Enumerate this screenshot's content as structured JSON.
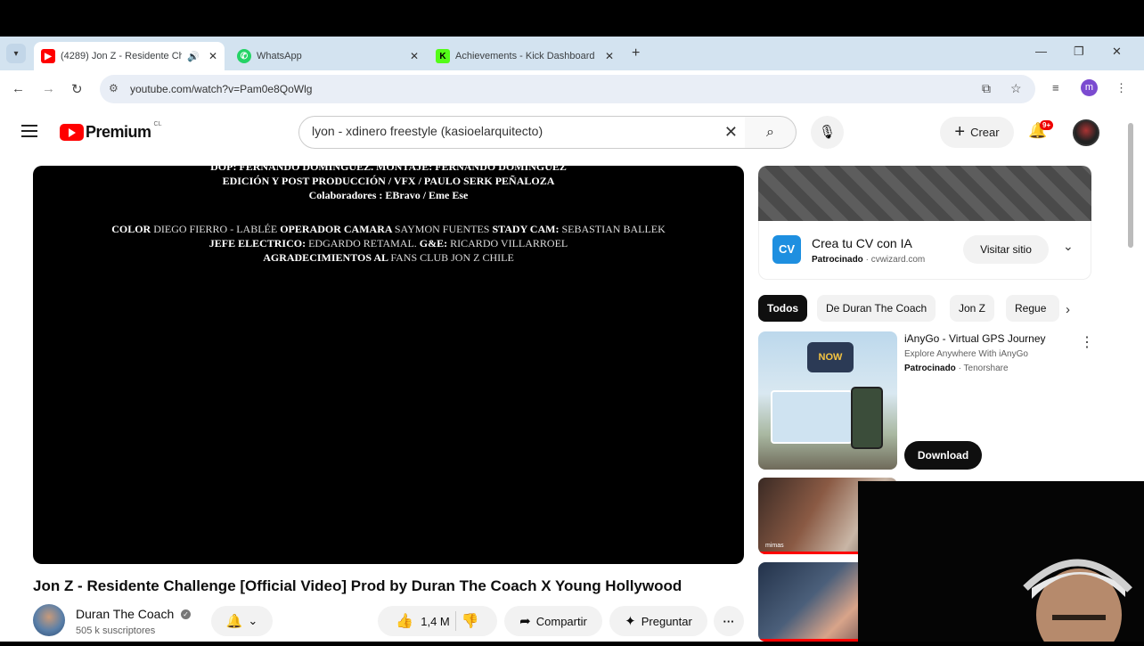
{
  "browser": {
    "tabs": [
      {
        "title": "(4289) Jon Z - Residente Ch",
        "active": true
      },
      {
        "title": "WhatsApp",
        "active": false
      },
      {
        "title": "Achievements - Kick Dashboard",
        "active": false
      }
    ],
    "url": "youtube.com/watch?v=Pam0e8QoWlg",
    "profile_initial": "m"
  },
  "header": {
    "brand": "Premium",
    "country": "CL",
    "search_value": "lyon - xdinero freestyle (kasioelarquitecto)",
    "create_label": "Crear",
    "notif_count": "9+"
  },
  "video": {
    "credits": [
      {
        "text": "DOP: FERNANDO DOMINGUEZ. MONTAJE: FERNANDO DOMINGUEZ"
      },
      {
        "text": "EDICIÓN Y POST PRODUCCIÓN / VFX / PAULO SERK PEÑALOZA"
      },
      {
        "text": "Colaboradores : EBravo / Eme Ese"
      }
    ],
    "credits2": {
      "l1": {
        "a": "COLOR",
        "b": "DIEGO FIERRO - LABLÉE",
        "c": "OPERADOR CAMARA",
        "d": "SAYMON FUENTES",
        "e": "STADY CAM:",
        "f": "SEBASTIAN BALLEK"
      },
      "l2": {
        "a": "JEFE ELECTRICO:",
        "b": "EDGARDO RETAMAL.",
        "c": "G&E:",
        "d": "RICARDO VILLARROEL"
      },
      "l3": {
        "a": "AGRADECIMIENTOS AL",
        "b": "FANS CLUB JON Z CHILE"
      }
    },
    "title": "Jon Z - Residente Challenge [Official Video] Prod by Duran The Coach X Young Hollywood",
    "channel": "Duran The Coach",
    "subscribers": "505 k suscriptores",
    "likes": "1,4 M",
    "share_label": "Compartir",
    "ask_label": "Preguntar"
  },
  "sidebar_ad": {
    "logo": "CV",
    "title": "Crea tu CV con IA",
    "sponsored": "Patrocinado",
    "domain": "cvwizard.com",
    "button": "Visitar sitio"
  },
  "chips": [
    "Todos",
    "De Duran The Coach",
    "Jon Z",
    "Regue"
  ],
  "recommendation": {
    "title": "iAnyGo - Virtual GPS Journey",
    "subtitle": "Explore Anywhere With iAnyGo",
    "sponsored": "Patrocinado",
    "advertiser": "Tenorshare",
    "button": "Download",
    "thumb_text": "NOW"
  },
  "thumb2_label": "mimas",
  "colors": {
    "accent": "#ff0000",
    "chrome_bg": "#d3e3f0"
  }
}
